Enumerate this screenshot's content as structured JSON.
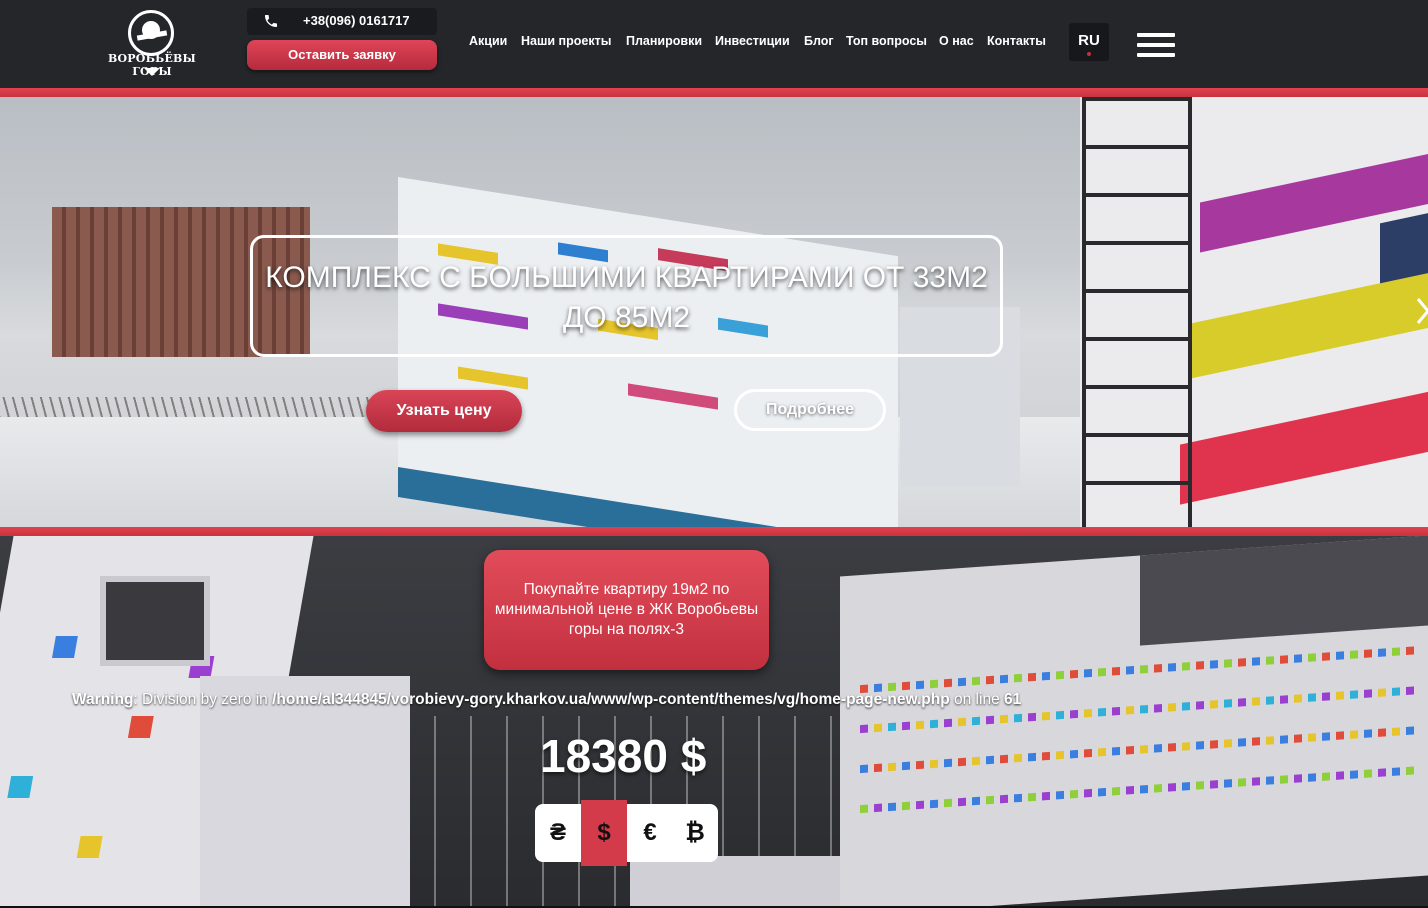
{
  "header": {
    "logo_text": "ВОРОБЬЁВЫ ГОРЫ",
    "phone": "+38(096) 0161717",
    "cta_label": "Оставить заявку",
    "nav": [
      "Акции",
      "Наши проекты",
      "Планировки",
      "Инвестиции",
      "Блог",
      "Топ вопросы",
      "О нас",
      "Контакты"
    ],
    "language": "RU",
    "icons": [
      "phone-icon",
      "hamburger-menu-icon",
      "logo-key-icon"
    ]
  },
  "hero": {
    "title": "КОМПЛЕКС С БОЛЬШИМИ КВАРТИРАМИ ОТ 33М2 ДО 85М2",
    "price_button": "Узнать цену",
    "more_button": "Подробнее",
    "next_icon": "chevron-right-icon"
  },
  "promo": {
    "text": "Покупайте квартиру 19м2 по минимальной цене в ЖК Воробьевы горы на полях-3"
  },
  "warning": {
    "label": "Warning",
    "message": ": Division by zero in ",
    "path": "/home/al344845/vorobievy-gory.kharkov.ua/www/wp-content/themes/vg/home-page-new.php",
    "line_text": " on line ",
    "line": "61"
  },
  "price": {
    "value": "18380 $"
  },
  "currencies": [
    {
      "symbol": "₴",
      "active": false
    },
    {
      "symbol": "$",
      "active": true
    },
    {
      "symbol": "€",
      "active": false
    },
    {
      "symbol": "₿",
      "active": false
    }
  ],
  "colors": {
    "accent": "#d33b4b",
    "header_bg": "#24262a"
  }
}
